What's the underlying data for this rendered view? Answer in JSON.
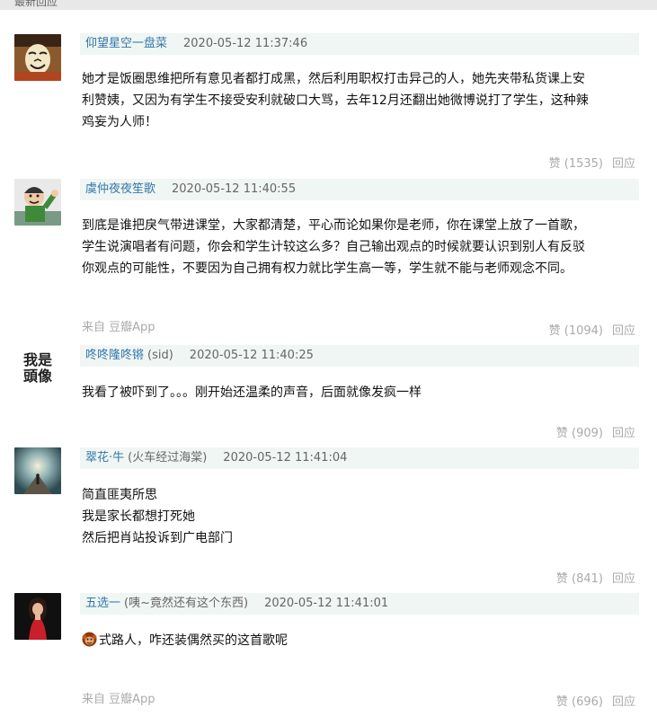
{
  "header": {
    "title": "最新回应"
  },
  "comments": [
    {
      "username": "仰望星空一盘菜",
      "extra": "",
      "time": "2020-05-12 11:37:46",
      "lines": [
        "她才是饭圈思维把所有意见者都打成黑，然后利用职权打击异己的人，她先夹带私货课上安",
        "利赞姨，又因为有学生不接受安利就破口大骂，去年12月还翻出她微博说打了学生，这种辣",
        "鸡妄为人师！"
      ],
      "source": "",
      "vote_label": "赞 (1535)",
      "reply_label": "回应",
      "avatar_icon": "masked-face-avatar"
    },
    {
      "username": "虞仲夜夜笙歌",
      "extra": "",
      "time": "2020-05-12 11:40:55",
      "lines": [
        "到底是谁把戾气带进课堂，大家都清楚，平心而论如果你是老师，你在课堂上放了一首歌，",
        "学生说演唱者有问题，你会和学生计较这么多？自己输出观点的时候就要认识到别人有反驳",
        "你观点的可能性，不要因为自己拥有权力就比学生高一等，学生就不能与老师观念不同。"
      ],
      "source": "来自 豆瓣App",
      "vote_label": "赞 (1094)",
      "reply_label": "回应",
      "avatar_icon": "cartoon-man-avatar"
    },
    {
      "username": "咚咚隆咚锵",
      "extra": "(sid)",
      "time": "2020-05-12 11:40:25",
      "lines": [
        "我看了被吓到了。。。刚开始还温柔的声音，后面就像发疯一样"
      ],
      "source": "",
      "vote_label": "赞 (909)",
      "reply_label": "回应",
      "avatar_text_1": "我是",
      "avatar_text_2": "頭像"
    },
    {
      "username": "翠花·牛",
      "extra": "(火车经过海棠)",
      "time": "2020-05-12 11:41:04",
      "lines": [
        "简直匪夷所思",
        "我是家长都想打死她",
        "然后把肖站投诉到广电部门"
      ],
      "source": "",
      "vote_label": "赞 (841)",
      "reply_label": "回应",
      "avatar_icon": "light-figure-avatar"
    },
    {
      "username": "五选一",
      "extra": "(咦~竟然还有这个东西)",
      "time": "2020-05-12 11:41:01",
      "lines": [
        "式路人，咋还装偶然买的这首歌呢"
      ],
      "source": "来自 豆瓣App",
      "vote_label": "赞 (696)",
      "reply_label": "回应",
      "avatar_icon": "singer-avatar",
      "emoji_icon": "monkey-emoji-icon"
    }
  ]
}
